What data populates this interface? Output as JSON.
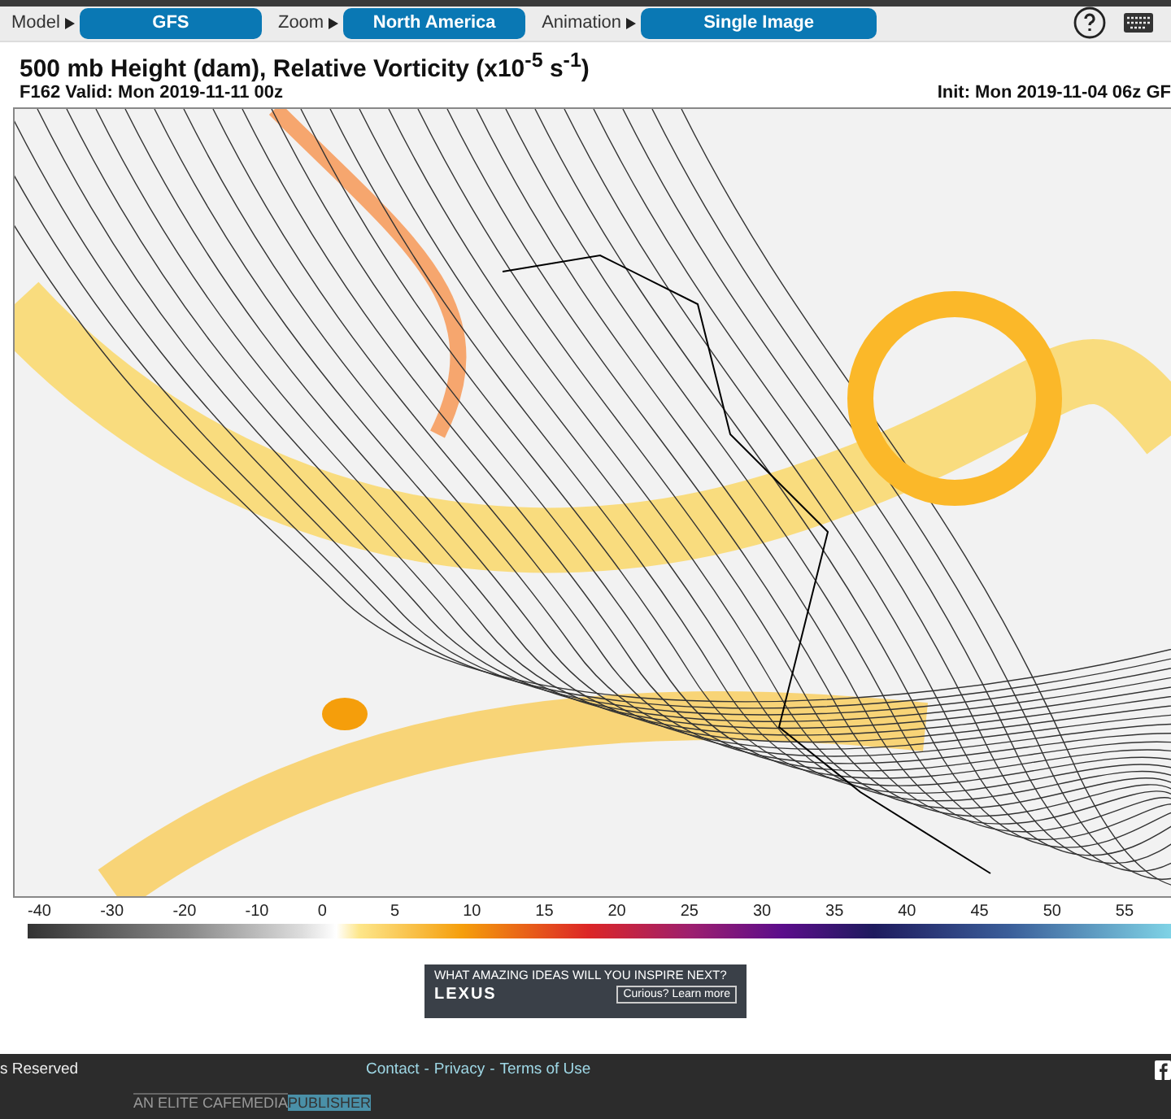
{
  "toolbar": {
    "controls": [
      {
        "label": "Model",
        "value": "GFS"
      },
      {
        "label": "Zoom",
        "value": "North America"
      },
      {
        "label": "Animation",
        "value": "Single Image"
      }
    ]
  },
  "header": {
    "title": "500 mb Height (dam), Relative Vorticity (x10$^{-5}$ s$^{-1}$)",
    "valid": "F162 Valid: Mon 2019-11-11 00z",
    "init": "Init: Mon 2019-11-04 06z GF"
  },
  "colorbar": {
    "ticks": [
      "-40",
      "-30",
      "-20",
      "-10",
      "0",
      "5",
      "10",
      "15",
      "20",
      "25",
      "30",
      "35",
      "40",
      "45",
      "50",
      "55"
    ]
  },
  "ad": {
    "headline": "WHAT AMAZING IDEAS WILL YOU INSPIRE NEXT?",
    "brand": "LEXUS",
    "cta": "Curious? Learn more"
  },
  "footer": {
    "rights": "s Reserved",
    "links": [
      "Contact",
      "Privacy",
      "Terms of Use"
    ],
    "separator": "-",
    "publisher": "AN ELITE CAFEMEDIA",
    "publisher_tag": "PUBLISHER"
  }
}
